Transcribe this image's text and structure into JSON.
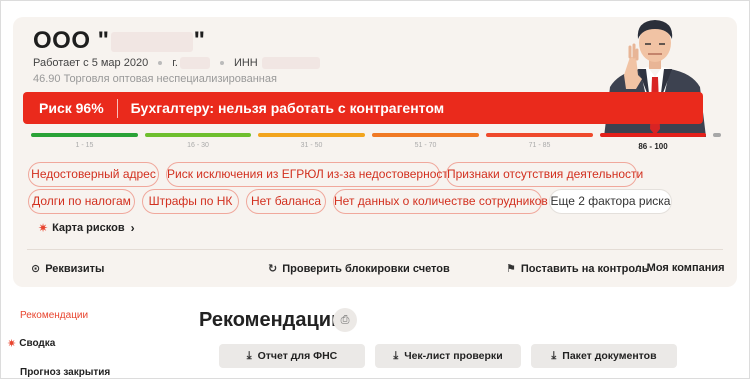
{
  "company": {
    "prefix": "ООО \"",
    "suffix": "\"",
    "works_since": "Работает с 5 мар 2020",
    "city_prefix": "г.",
    "inn_label": "ИНН",
    "okved": "46.90 Торговля оптовая неспециализированная"
  },
  "risk": {
    "percent_label": "Риск 96%",
    "percent": 96,
    "message": "Бухгалтеру: нельзя работать с контрагентом",
    "color": "#ea2a1c"
  },
  "scale": [
    {
      "label": "1 - 15",
      "color": "#2aa337",
      "active": false
    },
    {
      "label": "16 - 30",
      "color": "#6fbf2e",
      "active": false
    },
    {
      "label": "31 - 50",
      "color": "#f2a51e",
      "active": false
    },
    {
      "label": "51 - 70",
      "color": "#f07a25",
      "active": false
    },
    {
      "label": "71 - 85",
      "color": "#ef4a2c",
      "active": false
    },
    {
      "label": "86 - 100",
      "color": "#e3201b",
      "active": true
    },
    {
      "label": "",
      "color": "#a7a7a7",
      "active": false
    }
  ],
  "factors": [
    "Недостоверный адрес",
    "Риск исключения из ЕГРЮЛ из-за недостоверности",
    "Признаки отсутствия деятельности",
    "Долги по налогам",
    "Штрафы по НК",
    "Нет баланса",
    "Нет данных о количестве сотрудников"
  ],
  "more_factors": "Еще 2 фактора риска",
  "risk_map": {
    "label": "Карта рисков",
    "icon": "gear-icon"
  },
  "actions": {
    "requisites": "Реквизиты",
    "check_blocks": "Проверить блокировки счетов",
    "monitor": "Поставить на контроль",
    "my_company": "Моя компания"
  },
  "sidebar": {
    "items": [
      {
        "label": "Рекомендации",
        "active": true
      },
      {
        "label": "Сводка",
        "active": false
      },
      {
        "label": "Прогноз закрытия",
        "active": false
      }
    ]
  },
  "recommendations": {
    "title": "Рекомендации",
    "buttons": [
      "Отчет для ФНС",
      "Чек-лист проверки",
      "Пакет документов"
    ]
  }
}
